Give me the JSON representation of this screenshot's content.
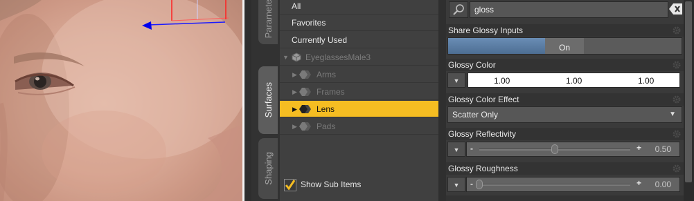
{
  "tabs": {
    "parameters": "Paramete",
    "surfaces": "Surfaces",
    "shaping": "Shaping"
  },
  "tree": {
    "all": "All",
    "favorites": "Favorites",
    "currently_used": "Currently Used",
    "root": "EyeglassesMale3",
    "items": [
      "Arms",
      "Frames",
      "Lens",
      "Pads"
    ],
    "selected": "Lens",
    "show_sub_items": "Show Sub Items",
    "show_sub_items_checked": true
  },
  "search": {
    "value": "gloss",
    "icon": "search-icon",
    "clear_icon": "clear-icon"
  },
  "properties": {
    "share_glossy_inputs": {
      "label": "Share Glossy Inputs",
      "value": "On"
    },
    "glossy_color": {
      "label": "Glossy Color",
      "r": "1.00",
      "g": "1.00",
      "b": "1.00"
    },
    "glossy_color_effect": {
      "label": "Glossy Color Effect",
      "value": "Scatter Only"
    },
    "glossy_reflectivity": {
      "label": "Glossy Reflectivity",
      "value": "0.50",
      "fraction": 0.5
    },
    "glossy_roughness": {
      "label": "Glossy Roughness",
      "value": "0.00",
      "fraction": 0.0
    }
  },
  "colors": {
    "selection": "#f5bd22",
    "toggle_on": "#5e7fa3"
  }
}
